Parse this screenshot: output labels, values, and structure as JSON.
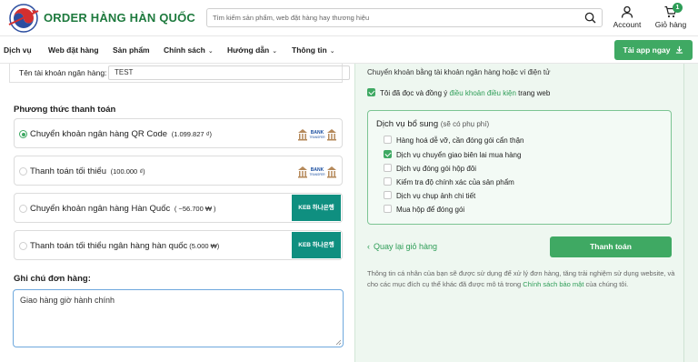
{
  "header": {
    "brand": "ORDER HÀNG HÀN QUỐC",
    "search_placeholder": "Tìm kiếm sản phẩm, web đặt hàng hay thương hiệu",
    "account_label": "Account",
    "cart_label": "Giỏ hàng",
    "cart_count": "1"
  },
  "nav": {
    "items": [
      {
        "label": "Dịch vụ"
      },
      {
        "label": "Web đặt hàng"
      },
      {
        "label": "Sản phẩm"
      },
      {
        "label": "Chính sách",
        "chevron": "⌄"
      },
      {
        "label": "Hướng dẫn",
        "chevron": "⌄"
      },
      {
        "label": "Thông tin",
        "chevron": "⌄"
      }
    ],
    "app_button": "Tải app ngay"
  },
  "left": {
    "account_label": "Tên tài khoản ngân hàng:",
    "account_value": "TEST",
    "payment_title": "Phương thức thanh toán",
    "payments": [
      {
        "label": "Chuyển khoản ngân hàng QR Code",
        "note": "(1.099.827 ₫)",
        "selected": true,
        "logo": "bank-transfer"
      },
      {
        "label": "Thanh toán tối thiểu",
        "note": "(100.000 ₫)",
        "selected": false,
        "logo": "bank-transfer"
      },
      {
        "label": "Chuyển khoản ngân hàng Hàn Quốc",
        "note": "( ~56.700 ₩ )",
        "selected": false,
        "logo": "keb-hana"
      },
      {
        "label": "Thanh toán tối thiểu ngân hàng hàn quốc",
        "note": "(5.000 ₩)",
        "selected": false,
        "logo": "keb-hana"
      }
    ],
    "bank_logo_text": "BANK",
    "bank_logo_sub": "TRANSFER",
    "keb_logo_text": "KEB 하나은행",
    "note_title": "Ghi chú đơn hàng:",
    "note_value": "Giao hàng giờ hành chính"
  },
  "right": {
    "transfer_note": "Chuyển khoản bằng tài khoản ngân hàng hoặc ví điện tử",
    "agree_prefix": "Tôi đã đọc và đồng ý",
    "agree_link": "điều khoản điều kiện",
    "agree_suffix": "trang web",
    "agree_checked": true,
    "services_title": "Dịch vụ bổ sung",
    "services_sub": "(sẽ có phụ phí)",
    "services": [
      {
        "label": "Hàng hoá dễ vỡ, cần đóng gói cẩn thận",
        "checked": false
      },
      {
        "label": "Dịch vụ chuyển giao biên lai mua hàng",
        "checked": true
      },
      {
        "label": "Dịch vụ đóng gói hộp đôi",
        "checked": false
      },
      {
        "label": "Kiểm tra độ chính xác của sản phẩm",
        "checked": false
      },
      {
        "label": "Dịch vụ chụp ảnh chi tiết",
        "checked": false
      },
      {
        "label": "Mua hộp để đóng gói",
        "checked": false
      }
    ],
    "back_label": "Quay lại giỏ hàng",
    "checkout_label": "Thanh toán",
    "privacy_text": "Thông tin cá nhân của bạn sẽ được sử dụng để xử lý đơn hàng, tăng trải nghiệm sử dụng website, và cho các mục đích cụ thể khác đã được mô tả trong",
    "privacy_link": "Chính sách bảo mật",
    "privacy_suffix": "của chúng tôi."
  },
  "colors": {
    "brand_green": "#3fa963",
    "link_green": "#2e9d57",
    "panel_bg": "#eef7f0",
    "note_border": "#6ea8dd",
    "keb_teal": "#0f8f80"
  }
}
